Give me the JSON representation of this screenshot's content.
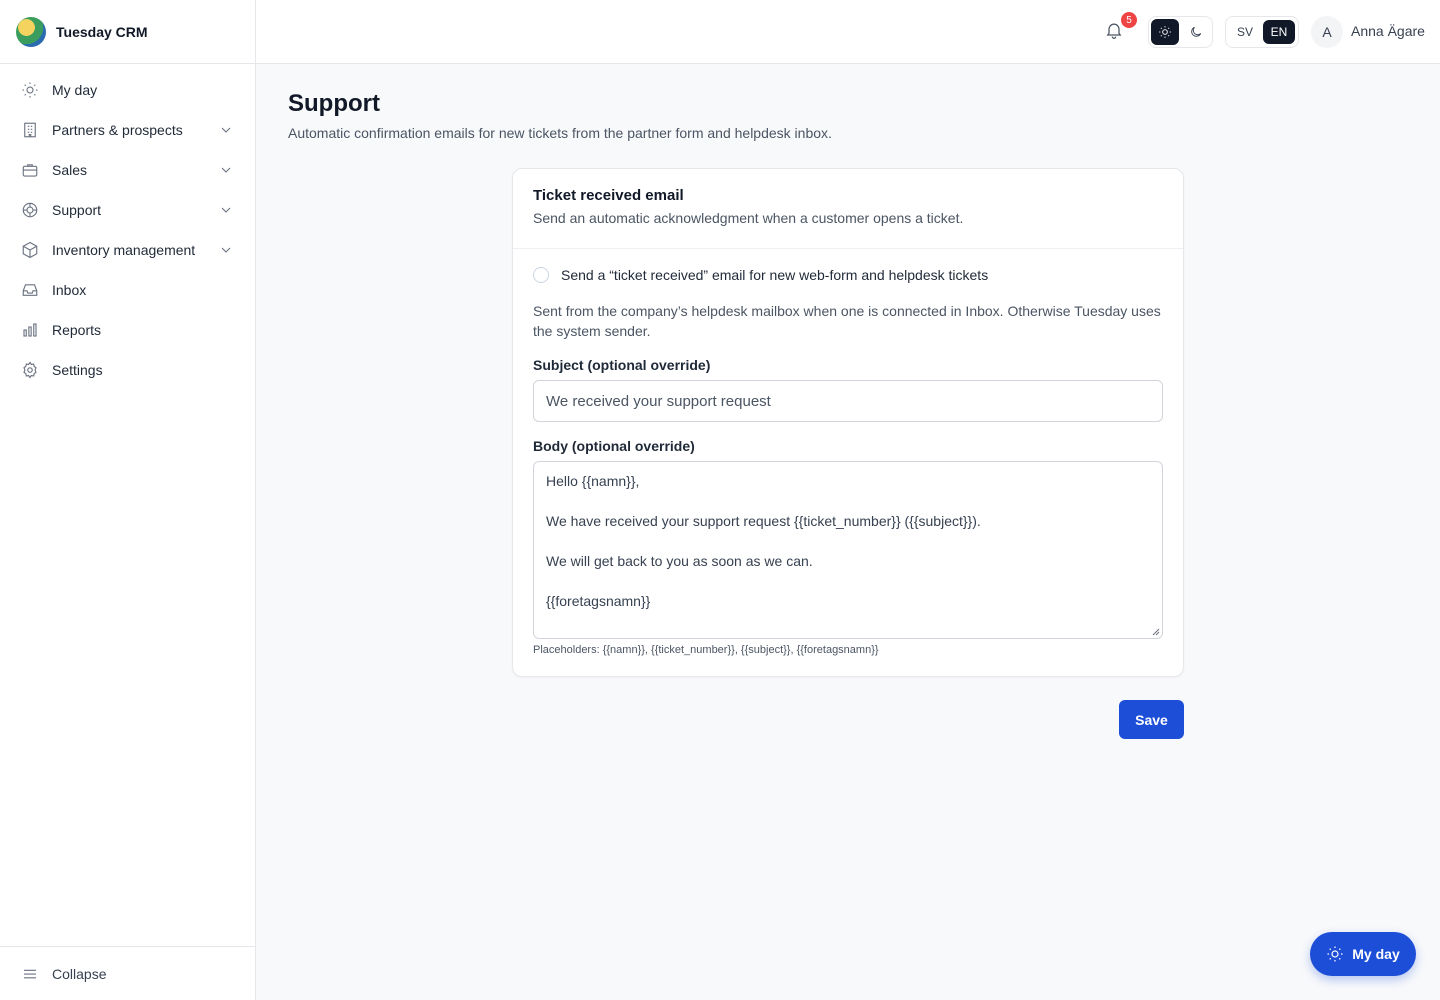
{
  "app": {
    "name": "Tuesday CRM"
  },
  "sidebar": {
    "items": [
      {
        "label": "My day",
        "icon": "sun-icon",
        "expandable": false
      },
      {
        "label": "Partners & prospects",
        "icon": "building-icon",
        "expandable": true
      },
      {
        "label": "Sales",
        "icon": "briefcase-icon",
        "expandable": true
      },
      {
        "label": "Support",
        "icon": "lifebuoy-icon",
        "expandable": true
      },
      {
        "label": "Inventory management",
        "icon": "cube-icon",
        "expandable": true
      },
      {
        "label": "Inbox",
        "icon": "inbox-icon",
        "expandable": false
      },
      {
        "label": "Reports",
        "icon": "bar-chart-icon",
        "expandable": false
      },
      {
        "label": "Settings",
        "icon": "gear-icon",
        "expandable": false
      }
    ],
    "collapse_label": "Collapse"
  },
  "topbar": {
    "notification_count": "5",
    "languages": [
      "SV",
      "EN"
    ],
    "active_language": "EN",
    "avatar_initial": "A",
    "user_name": "Anna Ägare"
  },
  "page": {
    "title": "Support",
    "subtitle": "Automatic confirmation emails for new tickets from the partner form and helpdesk inbox."
  },
  "card": {
    "title": "Ticket received email",
    "description": "Send an automatic acknowledgment when a customer opens a ticket.",
    "toggle_label": "Send a “ticket received” email for new web-form and helpdesk tickets",
    "toggle_checked": false,
    "hint": "Sent from the company’s helpdesk mailbox when one is connected in Inbox. Otherwise Tuesday uses the system sender.",
    "subject_label": "Subject (optional override)",
    "subject_placeholder": "We received your support request",
    "body_label": "Body (optional override)",
    "body_value": "Hello {{namn}},\n\nWe have received your support request {{ticket_number}} ({{subject}}).\n\nWe will get back to you as soon as we can.\n\n{{foretagsnamn}}",
    "placeholders_note": "Placeholders: {{namn}}, {{ticket_number}}, {{subject}}, {{foretagsnamn}}"
  },
  "actions": {
    "save_label": "Save"
  },
  "fab": {
    "label": "My day"
  },
  "colors": {
    "primary": "#1d4ed8",
    "badge": "#ef4444",
    "dark": "#111827"
  }
}
